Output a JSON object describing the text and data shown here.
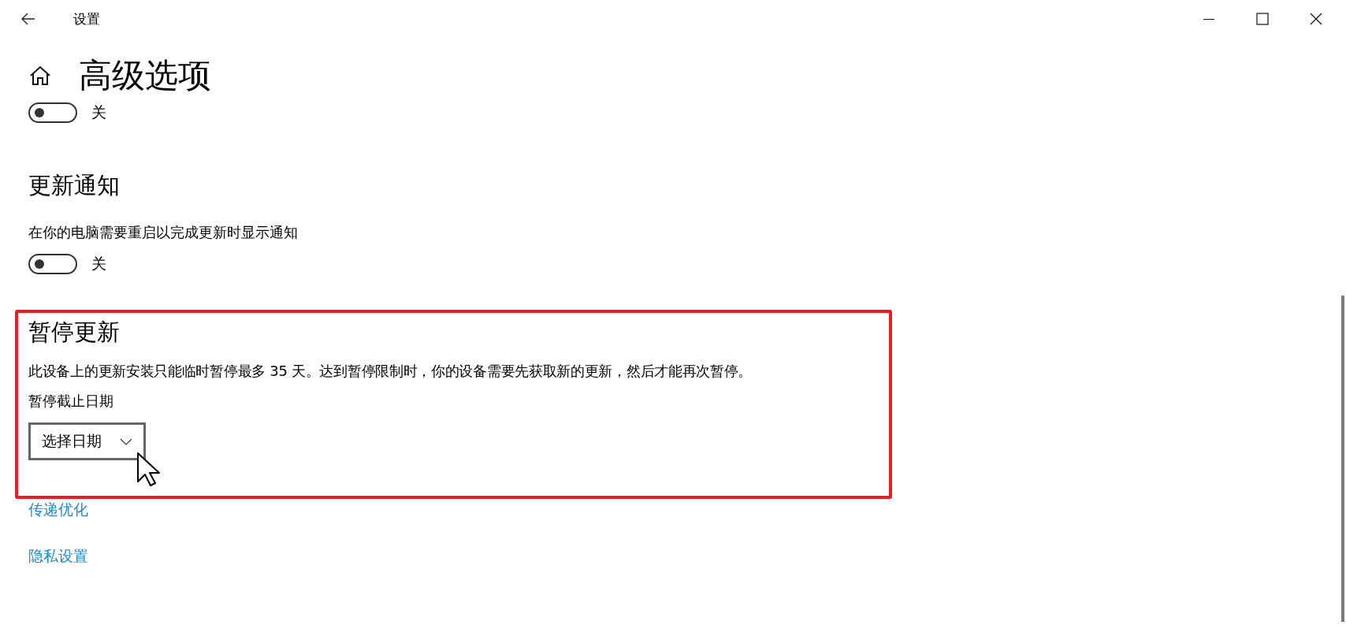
{
  "window": {
    "title": "设置"
  },
  "page": {
    "title": "高级选项"
  },
  "top_toggle": {
    "on": false,
    "label": "关"
  },
  "notifications": {
    "heading": "更新通知",
    "description": "在你的电脑需要重启以完成更新时显示通知",
    "toggle": {
      "on": false,
      "label": "关"
    }
  },
  "pause": {
    "highlighted": true,
    "heading": "暂停更新",
    "description": "此设备上的更新安装只能临时暂停最多 35 天。达到暂停限制时，你的设备需要先获取新的更新，然后才能再次暂停。",
    "date_label": "暂停截止日期",
    "dropdown": {
      "value": "选择日期"
    }
  },
  "links": [
    "传递优化",
    "隐私设置"
  ]
}
